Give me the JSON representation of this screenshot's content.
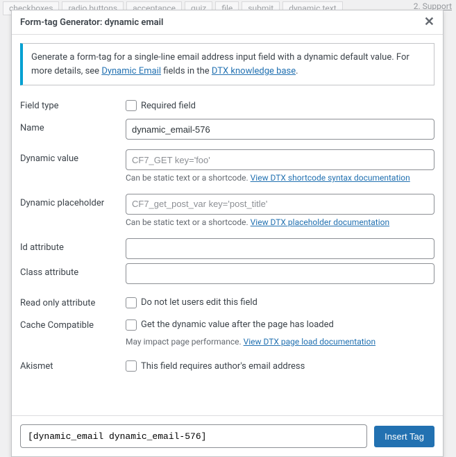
{
  "bg": {
    "tabs": [
      "checkboxes",
      "radio buttons",
      "acceptance",
      "quiz",
      "file",
      "submit",
      "dynamic text"
    ],
    "support": "2. Support"
  },
  "dialog": {
    "title": "Form-tag Generator: dynamic email",
    "info_prefix": "Generate a form-tag for a single-line email address input field with a dynamic default value. For more details, see ",
    "info_link1": "Dynamic Email",
    "info_mid": " fields in the ",
    "info_link2": "DTX knowledge base",
    "info_suffix": "."
  },
  "fields": {
    "field_type_label": "Field type",
    "required_label": "Required field",
    "name_label": "Name",
    "name_value": "dynamic_email-576",
    "dynvalue_label": "Dynamic value",
    "dynvalue_placeholder": "CF7_GET key='foo'",
    "dynvalue_hint_prefix": "Can be static text or a shortcode. ",
    "dynvalue_hint_link": "View DTX shortcode syntax documentation",
    "dynplaceholder_label": "Dynamic placeholder",
    "dynplaceholder_placeholder": "CF7_get_post_var key='post_title'",
    "dynplaceholder_hint_prefix": "Can be static text or a shortcode. ",
    "dynplaceholder_hint_link": "View DTX placeholder documentation",
    "id_label": "Id attribute",
    "class_label": "Class attribute",
    "readonly_label": "Read only attribute",
    "readonly_checkbox_label": "Do not let users edit this field",
    "cache_label": "Cache Compatible",
    "cache_checkbox_label": "Get the dynamic value after the page has loaded",
    "cache_hint_prefix": "May impact page performance. ",
    "cache_hint_link": "View DTX page load documentation",
    "akismet_label": "Akismet",
    "akismet_checkbox_label": "This field requires author's email address"
  },
  "footer": {
    "tag_output": "[dynamic_email dynamic_email-576]",
    "insert_label": "Insert Tag"
  }
}
